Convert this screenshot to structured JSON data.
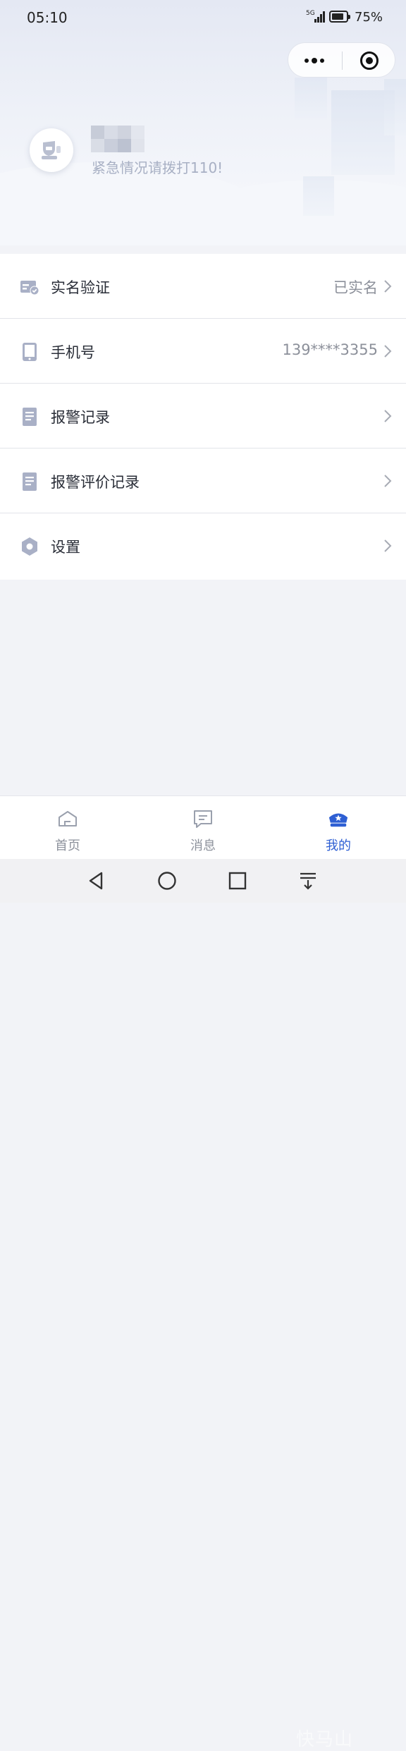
{
  "status_bar": {
    "time": "05:10",
    "network": "5G",
    "battery_percent": "75%"
  },
  "profile": {
    "tagline": "紧急情况请拨打110!"
  },
  "menu": [
    {
      "label": "实名验证",
      "value": "已实名",
      "icon": "id-card-check-icon"
    },
    {
      "label": "手机号",
      "value": "139****3355",
      "icon": "phone-icon"
    },
    {
      "label": "报警记录",
      "value": "",
      "icon": "document-icon"
    },
    {
      "label": "报警评价记录",
      "value": "",
      "icon": "document-icon"
    },
    {
      "label": "设置",
      "value": "",
      "icon": "hexagon-settings-icon"
    }
  ],
  "tabbar": {
    "tabs": [
      {
        "label": "首页",
        "icon": "home-icon",
        "active": false
      },
      {
        "label": "消息",
        "icon": "message-icon",
        "active": false
      },
      {
        "label": "我的",
        "icon": "police-cap-icon",
        "active": true
      }
    ]
  },
  "colors": {
    "accent": "#2e5fd3",
    "icon_grey": "#a9b0c6",
    "background": "#f2f3f7"
  },
  "watermark": "快马山"
}
